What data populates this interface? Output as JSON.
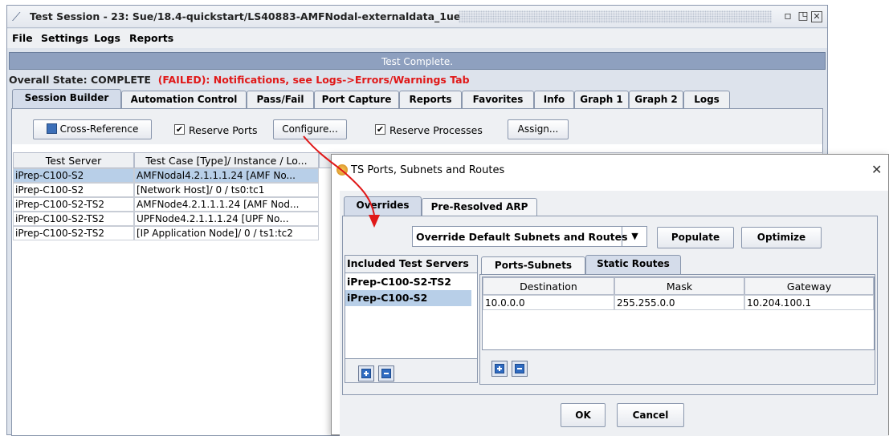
{
  "window": {
    "title": "Test Session - 23: Sue/18.4-quickstart/LS40883-AMFNodal-externaldata_1ue",
    "menu": [
      "File",
      "Settings",
      "Logs",
      "Reports"
    ],
    "status_text": "Test Complete.",
    "overall_prefix": "Overall State: COMPLETE",
    "overall_failed": "(FAILED): Notifications, see Logs->Errors/Warnings Tab",
    "tabs": [
      "Session Builder",
      "Automation Control",
      "Pass/Fail",
      "Port Capture",
      "Reports",
      "Favorites",
      "Info",
      "Graph 1",
      "Graph 2",
      "Logs"
    ],
    "active_tab": "Session Builder",
    "toolbar": {
      "cross_reference": "Cross-Reference",
      "reserve_ports": "Reserve Ports",
      "configure": "Configure...",
      "reserve_processes": "Reserve Processes",
      "assign": "Assign..."
    },
    "table": {
      "columns": [
        "Test Server",
        "Test Case [Type]/ Instance / Lo..."
      ],
      "rows": [
        [
          "iPrep-C100-S2",
          "AMFNodal4.2.1.1.1.24 [AMF No..."
        ],
        [
          "iPrep-C100-S2",
          "[Network Host]/ 0 / ts0:tc1"
        ],
        [
          "iPrep-C100-S2-TS2",
          "AMFNode4.2.1.1.1.24 [AMF Nod..."
        ],
        [
          "iPrep-C100-S2-TS2",
          "UPFNode4.2.1.1.1.24 [UPF No..."
        ],
        [
          "iPrep-C100-S2-TS2",
          "[IP Application Node]/ 0 / ts1:tc2"
        ]
      ]
    }
  },
  "dialog": {
    "title": "TS Ports, Subnets and Routes",
    "tabs": [
      "Overrides",
      "Pre-Resolved ARP"
    ],
    "dropdown_value": "Override Default Subnets and Routes",
    "populate": "Populate",
    "optimize": "Optimize",
    "servers_header": "Included Test Servers",
    "servers": [
      "iPrep-C100-S2-TS2",
      "iPrep-C100-S2"
    ],
    "inner_tabs": [
      "Ports-Subnets",
      "Static Routes"
    ],
    "routes": {
      "columns": [
        "Destination",
        "Mask",
        "Gateway"
      ],
      "rows": [
        [
          "10.0.0.0",
          "255.255.0.0",
          "10.204.100.1"
        ]
      ]
    },
    "ok": "OK",
    "cancel": "Cancel"
  },
  "colors": {
    "failed_text": "#e01818",
    "annotation_arrow": "#e01818",
    "status_bar": "#8ea0bf",
    "selection": "#b8cfe8"
  },
  "icons": [
    "graph-icon",
    "minimize-icon",
    "maximize-icon",
    "close-icon",
    "cross-reference-icon",
    "app-icon",
    "dropdown-arrow-icon",
    "add-icon",
    "remove-icon"
  ]
}
